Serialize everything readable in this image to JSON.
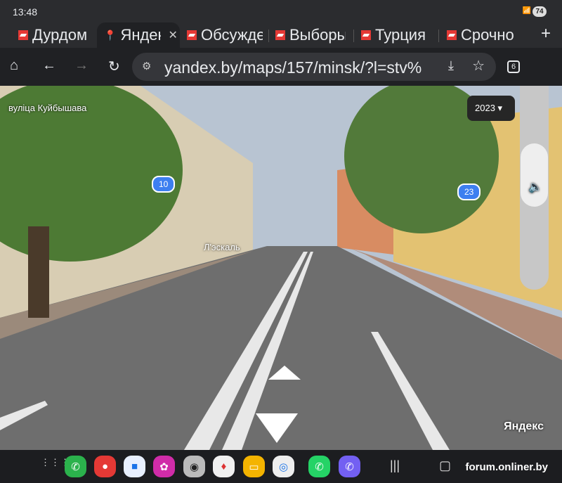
{
  "status": {
    "time": "13:48",
    "battery": "74"
  },
  "tabs": [
    {
      "title": "Дурдом",
      "active": false
    },
    {
      "title": "Яндекс",
      "active": true
    },
    {
      "title": "Обсуждение",
      "active": false
    },
    {
      "title": "Выборы",
      "active": false
    },
    {
      "title": "Турция",
      "active": false
    },
    {
      "title": "Срочно",
      "active": false
    }
  ],
  "toolbar": {
    "url": "yandex.by/maps/157/minsk/?l=stv%",
    "tab_count": "6"
  },
  "streetview": {
    "street_label": "вуліца Куйбышава",
    "year": "2023",
    "house_left": "10",
    "house_right": "23",
    "poi": "Л'эскаль",
    "logo": "Яндекс"
  },
  "dock": {
    "watermark": "forum.onliner.by"
  }
}
